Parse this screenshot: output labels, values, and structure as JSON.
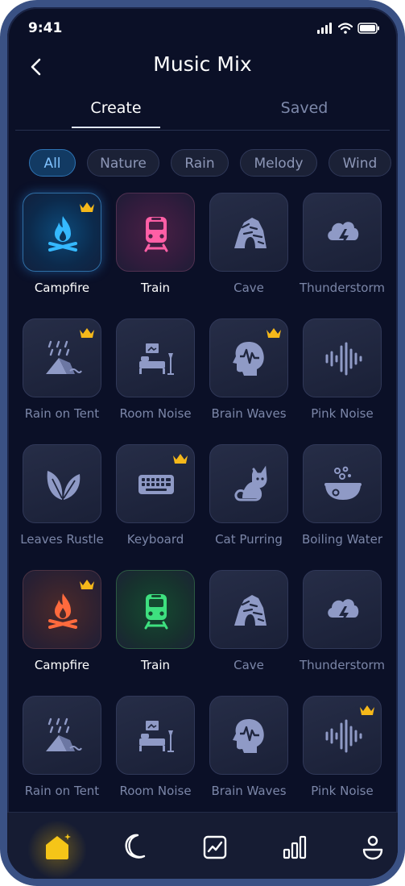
{
  "status": {
    "time": "9:41"
  },
  "header": {
    "title": "Music Mix"
  },
  "tabs": [
    {
      "label": "Create"
    },
    {
      "label": "Saved"
    }
  ],
  "chips": [
    {
      "label": "All"
    },
    {
      "label": "Nature"
    },
    {
      "label": "Rain"
    },
    {
      "label": "Melody"
    },
    {
      "label": "Wind"
    }
  ],
  "tiles": [
    {
      "label": "Campfire",
      "icon": "campfire-icon"
    },
    {
      "label": "Train",
      "icon": "train-icon"
    },
    {
      "label": "Cave",
      "icon": "cave-icon"
    },
    {
      "label": "Thunderstorm",
      "icon": "thunderstorm-icon"
    },
    {
      "label": "Rain on Tent",
      "icon": "rain-tent-icon"
    },
    {
      "label": "Room Noise",
      "icon": "room-icon"
    },
    {
      "label": "Brain Waves",
      "icon": "brain-icon"
    },
    {
      "label": "Pink Noise",
      "icon": "soundwave-icon"
    },
    {
      "label": "Leaves Rustle",
      "icon": "leaves-icon"
    },
    {
      "label": "Keyboard",
      "icon": "keyboard-icon"
    },
    {
      "label": "Cat Purring",
      "icon": "cat-icon"
    },
    {
      "label": "Boiling Water",
      "icon": "boiling-icon"
    },
    {
      "label": "Campfire",
      "icon": "campfire-icon"
    },
    {
      "label": "Train",
      "icon": "train-icon"
    },
    {
      "label": "Cave",
      "icon": "cave-icon"
    },
    {
      "label": "Thunderstorm",
      "icon": "thunderstorm-icon"
    },
    {
      "label": "Rain on Tent",
      "icon": "rain-tent-icon"
    },
    {
      "label": "Room Noise",
      "icon": "room-icon"
    },
    {
      "label": "Brain Waves",
      "icon": "brain-icon"
    },
    {
      "label": "Pink Noise",
      "icon": "soundwave-icon"
    }
  ],
  "nav": [
    {
      "icon": "home-icon"
    },
    {
      "icon": "moon-icon"
    },
    {
      "icon": "chart-icon"
    },
    {
      "icon": "bar-chart-icon"
    },
    {
      "icon": "profile-icon"
    }
  ],
  "colors": {
    "accent": "#f5c518",
    "background": "#0b1027",
    "frame": "#3a5184"
  }
}
